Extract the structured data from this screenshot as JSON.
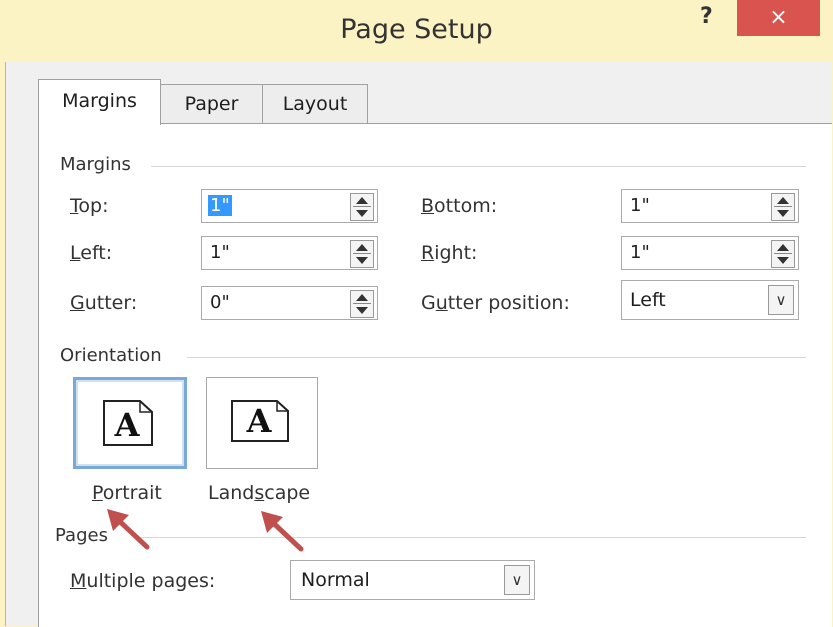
{
  "window": {
    "title": "Page Setup",
    "help": "?",
    "close": "×"
  },
  "tabs": [
    {
      "label": "Margins"
    },
    {
      "label": "Paper"
    },
    {
      "label": "Layout"
    }
  ],
  "margins": {
    "group": "Margins",
    "top": {
      "label_prefix": "",
      "label_u": "T",
      "label_rest": "op:",
      "value": "1\""
    },
    "bottom": {
      "label_u": "B",
      "label_rest": "ottom:",
      "value": "1\""
    },
    "left": {
      "label_u": "L",
      "label_rest": "eft:",
      "value": "1\""
    },
    "right": {
      "label_u": "R",
      "label_rest": "ight:",
      "value": "1\""
    },
    "gutter": {
      "label_u": "G",
      "label_rest": "utter:",
      "value": "0\""
    },
    "gutter_position": {
      "label_pre": "G",
      "label_u": "u",
      "label_rest": "tter position:",
      "value": "Left"
    }
  },
  "orientation": {
    "group": "Orientation",
    "glyph": "A",
    "portrait": {
      "label_u": "P",
      "label_rest": "ortrait"
    },
    "landscape": {
      "label_pre": "Land",
      "label_u": "s",
      "label_rest": "cape"
    }
  },
  "pages": {
    "group": "Pages",
    "multiple": {
      "label_u": "M",
      "label_rest": "ultiple pages:",
      "value": "Normal"
    }
  },
  "colors": {
    "accent": "#3399ff",
    "close": "#d9534f",
    "annotation_arrow": "#c0504d"
  },
  "icons": [
    "help-icon",
    "close-icon",
    "spin-up-icon",
    "spin-down-icon",
    "dropdown-icon",
    "portrait-page-icon",
    "landscape-page-icon",
    "annotation-arrow-icon"
  ]
}
